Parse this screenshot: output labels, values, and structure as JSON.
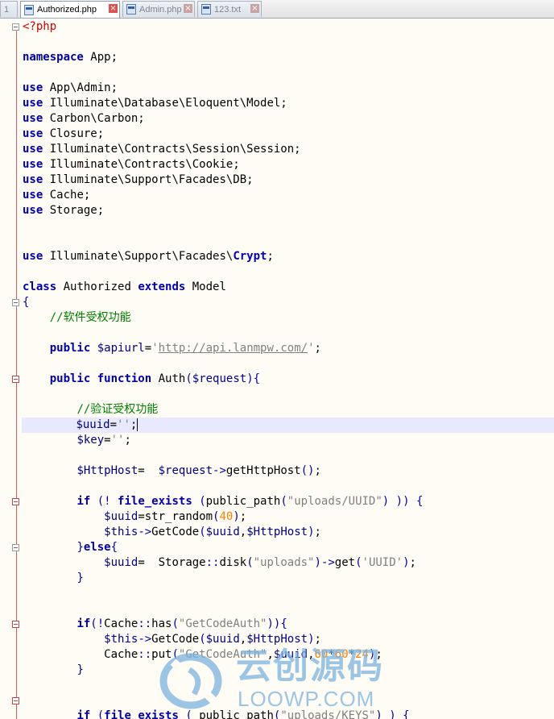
{
  "tabs": [
    {
      "label": "1",
      "active": false,
      "closable": false
    },
    {
      "label": "Authorized.php",
      "active": true,
      "closable": true
    },
    {
      "label": "Admin.php",
      "active": false,
      "closable": true
    },
    {
      "label": "123.txt",
      "active": false,
      "closable": true
    }
  ],
  "editor": {
    "language": "php",
    "current_line": 27,
    "colors": {
      "keyword": "#0000a8",
      "comment": "#008000",
      "string": "#808080",
      "number": "#ff8000",
      "php_tag": "#d00000",
      "current_line_bg": "#e8e8ff",
      "fold_marker": "#c04848"
    },
    "lines": [
      [
        [
          "ph",
          "<?php"
        ]
      ],
      [],
      [
        [
          "kw",
          "namespace"
        ],
        [
          "tx",
          " App;"
        ]
      ],
      [],
      [
        [
          "kw",
          "use"
        ],
        [
          "tx",
          " App\\Admin;"
        ]
      ],
      [
        [
          "kw",
          "use"
        ],
        [
          "tx",
          " Illuminate\\Database\\Eloquent\\Model;"
        ]
      ],
      [
        [
          "kw",
          "use"
        ],
        [
          "tx",
          " Carbon\\Carbon;"
        ]
      ],
      [
        [
          "kw",
          "use"
        ],
        [
          "tx",
          " Closure;"
        ]
      ],
      [
        [
          "kw",
          "use"
        ],
        [
          "tx",
          " Illuminate\\Contracts\\Session\\Session;"
        ]
      ],
      [
        [
          "kw",
          "use"
        ],
        [
          "tx",
          " Illuminate\\Contracts\\Cookie;"
        ]
      ],
      [
        [
          "kw",
          "use"
        ],
        [
          "tx",
          " Illuminate\\Support\\Facades\\DB;"
        ]
      ],
      [
        [
          "kw",
          "use"
        ],
        [
          "tx",
          " Cache;"
        ]
      ],
      [
        [
          "kw",
          "use"
        ],
        [
          "tx",
          " Storage;"
        ]
      ],
      [],
      [],
      [
        [
          "kw",
          "use"
        ],
        [
          "tx",
          " Illuminate\\Support\\Facades\\"
        ],
        [
          "kw",
          "Crypt"
        ],
        [
          "tx",
          ";"
        ]
      ],
      [],
      [
        [
          "kw",
          "class"
        ],
        [
          "tx",
          " Authorized "
        ],
        [
          "kw",
          "extends"
        ],
        [
          "tx",
          " Model"
        ]
      ],
      [
        [
          "op",
          "{"
        ]
      ],
      [
        [
          "tx",
          "    "
        ],
        [
          "cm",
          "//软件受权功能"
        ]
      ],
      [],
      [
        [
          "tx",
          "    "
        ],
        [
          "kw",
          "public"
        ],
        [
          "tx",
          " "
        ],
        [
          "vr",
          "$apiurl"
        ],
        [
          "tx",
          "="
        ],
        [
          "st",
          "'"
        ],
        [
          "lk",
          "http://api.lanmpw.com/"
        ],
        [
          "st",
          "'"
        ],
        [
          "tx",
          ";"
        ]
      ],
      [],
      [
        [
          "tx",
          "    "
        ],
        [
          "kw",
          "public"
        ],
        [
          "tx",
          " "
        ],
        [
          "kw",
          "function"
        ],
        [
          "tx",
          " Auth"
        ],
        [
          "op",
          "("
        ],
        [
          "vr",
          "$request"
        ],
        [
          "op",
          "){"
        ]
      ],
      [],
      [
        [
          "tx",
          "        "
        ],
        [
          "cm",
          "//验证受权功能"
        ]
      ],
      [
        [
          "tx",
          "        "
        ],
        [
          "vr",
          "$uuid"
        ],
        [
          "tx",
          "="
        ],
        [
          "st",
          "''"
        ],
        [
          "tx",
          ";"
        ]
      ],
      [
        [
          "tx",
          "        "
        ],
        [
          "vr",
          "$key"
        ],
        [
          "tx",
          "="
        ],
        [
          "st",
          "''"
        ],
        [
          "tx",
          ";"
        ]
      ],
      [],
      [
        [
          "tx",
          "        "
        ],
        [
          "vr",
          "$HttpHost"
        ],
        [
          "tx",
          "=  "
        ],
        [
          "vr",
          "$request"
        ],
        [
          "op",
          "->"
        ],
        [
          "tx",
          "getHttpHost"
        ],
        [
          "op",
          "()"
        ],
        [
          "tx",
          ";"
        ]
      ],
      [],
      [
        [
          "tx",
          "        "
        ],
        [
          "kw",
          "if"
        ],
        [
          "tx",
          " "
        ],
        [
          "op",
          "(!"
        ],
        [
          "tx",
          " "
        ],
        [
          "kw",
          "file_exists"
        ],
        [
          "tx",
          " "
        ],
        [
          "op",
          "("
        ],
        [
          "tx",
          "public_path"
        ],
        [
          "op",
          "("
        ],
        [
          "st",
          "\"uploads/UUID\""
        ],
        [
          "op",
          ")"
        ],
        [
          "tx",
          " "
        ],
        [
          "op",
          "))"
        ],
        [
          "tx",
          " "
        ],
        [
          "op",
          "{"
        ]
      ],
      [
        [
          "tx",
          "            "
        ],
        [
          "vr",
          "$uuid"
        ],
        [
          "tx",
          "=str_random"
        ],
        [
          "op",
          "("
        ],
        [
          "nm",
          "40"
        ],
        [
          "op",
          ")"
        ],
        [
          "tx",
          ";"
        ]
      ],
      [
        [
          "tx",
          "            "
        ],
        [
          "vr",
          "$this"
        ],
        [
          "op",
          "->"
        ],
        [
          "tx",
          "GetCode"
        ],
        [
          "op",
          "("
        ],
        [
          "vr",
          "$uuid"
        ],
        [
          "tx",
          ","
        ],
        [
          "vr",
          "$HttpHost"
        ],
        [
          "op",
          ")"
        ],
        [
          "tx",
          ";"
        ]
      ],
      [
        [
          "tx",
          "        "
        ],
        [
          "op",
          "}"
        ],
        [
          "kw",
          "else"
        ],
        [
          "op",
          "{"
        ]
      ],
      [
        [
          "tx",
          "            "
        ],
        [
          "vr",
          "$uuid"
        ],
        [
          "tx",
          "=  Storage"
        ],
        [
          "op",
          "::"
        ],
        [
          "tx",
          "disk"
        ],
        [
          "op",
          "("
        ],
        [
          "st",
          "\"uploads\""
        ],
        [
          "op",
          ")->"
        ],
        [
          "tx",
          "get"
        ],
        [
          "op",
          "("
        ],
        [
          "st",
          "'UUID'"
        ],
        [
          "op",
          ")"
        ],
        [
          "tx",
          ";"
        ]
      ],
      [
        [
          "tx",
          "        "
        ],
        [
          "op",
          "}"
        ]
      ],
      [],
      [],
      [
        [
          "tx",
          "        "
        ],
        [
          "kw",
          "if"
        ],
        [
          "op",
          "(!"
        ],
        [
          "tx",
          "Cache"
        ],
        [
          "op",
          "::"
        ],
        [
          "tx",
          "has"
        ],
        [
          "op",
          "("
        ],
        [
          "st",
          "\"GetCodeAuth\""
        ],
        [
          "op",
          "))"
        ],
        [
          "op",
          "{"
        ]
      ],
      [
        [
          "tx",
          "            "
        ],
        [
          "vr",
          "$this"
        ],
        [
          "op",
          "->"
        ],
        [
          "tx",
          "GetCode"
        ],
        [
          "op",
          "("
        ],
        [
          "vr",
          "$uuid"
        ],
        [
          "tx",
          ","
        ],
        [
          "vr",
          "$HttpHost"
        ],
        [
          "op",
          ")"
        ],
        [
          "tx",
          ";"
        ]
      ],
      [
        [
          "tx",
          "            Cache"
        ],
        [
          "op",
          "::"
        ],
        [
          "tx",
          "put"
        ],
        [
          "op",
          "("
        ],
        [
          "st",
          "\"GetCodeAuth\""
        ],
        [
          "tx",
          ","
        ],
        [
          "vr",
          "$uuid"
        ],
        [
          "tx",
          ","
        ],
        [
          "nm",
          "60"
        ],
        [
          "tx",
          "*"
        ],
        [
          "nm",
          "60"
        ],
        [
          "tx",
          "*"
        ],
        [
          "nm",
          "24"
        ],
        [
          "op",
          ")"
        ],
        [
          "tx",
          ";"
        ]
      ],
      [
        [
          "tx",
          "        "
        ],
        [
          "op",
          "}"
        ]
      ],
      [],
      [],
      [
        [
          "tx",
          "        "
        ],
        [
          "kw",
          "if"
        ],
        [
          "tx",
          " "
        ],
        [
          "op",
          "("
        ],
        [
          "kw",
          "file_exists"
        ],
        [
          "tx",
          " "
        ],
        [
          "op",
          "("
        ],
        [
          "tx",
          " public_path"
        ],
        [
          "op",
          "("
        ],
        [
          "st",
          "\"uploads/KEYS\""
        ],
        [
          "op",
          ")"
        ],
        [
          "tx",
          " "
        ],
        [
          "op",
          ")"
        ],
        [
          "tx",
          " "
        ],
        [
          "op",
          "{"
        ]
      ]
    ]
  },
  "watermark": {
    "cn_text": "云创源码",
    "en_text": "LOOWP.COM"
  }
}
